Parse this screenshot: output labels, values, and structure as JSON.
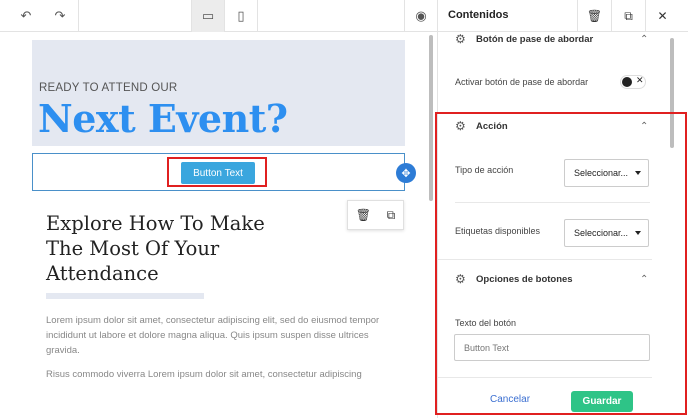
{
  "toolbar": {
    "undo_icon": "↶",
    "redo_icon": "↷",
    "desktop_icon": "▭",
    "mobile_icon": "▯",
    "preview_icon": "◉"
  },
  "canvas": {
    "hero_subtitle": "READY TO ATTEND OUR",
    "hero_title": "Next Event?",
    "button_text": "Button Text",
    "move_icon": "✥",
    "section_title": "Explore How To Make The Most Of Your Attendance",
    "paragraph_1": "Lorem ipsum dolor sit amet, consectetur adipiscing elit, sed do eiusmod tempor incididunt ut labore et dolore magna aliqua. Quis ipsum suspen disse ultrices gravida.",
    "paragraph_2": "Risus commodo viverra Lorem ipsum dolor sit amet, consectetur adipiscing"
  },
  "panel": {
    "title": "Contenidos",
    "delete_icon": "🗑",
    "duplicate_icon": "⧉",
    "close_icon": "✕",
    "boarding_section": "Botón de pase de abordar",
    "boarding_toggle_label": "Activar botón de pase de abordar",
    "toggle_x": "✕",
    "action_section": "Acción",
    "action_type_label": "Tipo de acción",
    "action_type_value": "Seleccionar...",
    "tags_label": "Etiquetas disponibles",
    "tags_value": "Seleccionar...",
    "button_options_section": "Opciones de botones",
    "button_text_label": "Texto del botón",
    "button_text_placeholder": "Button Text",
    "chevron_up": "⌃",
    "gear": "⚙"
  },
  "footer": {
    "cancel_label": "Cancelar",
    "save_label": "Guardar"
  },
  "colors": {
    "accent_blue": "#2d8ff0",
    "button_blue": "#3aa6de",
    "save_green": "#2ec487",
    "highlight_red": "#e02020"
  }
}
